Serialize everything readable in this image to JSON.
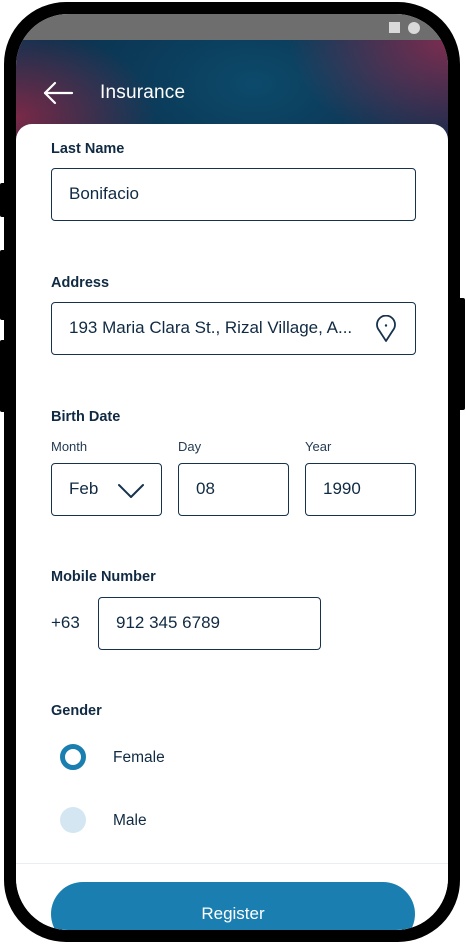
{
  "header": {
    "title": "Insurance",
    "back_icon": "arrow-left-icon"
  },
  "status_bar": {
    "icons": [
      "square-icon",
      "circle-icon",
      "triangle-icon"
    ]
  },
  "form": {
    "last_name": {
      "label": "Last Name",
      "value": "Bonifacio"
    },
    "address": {
      "label": "Address",
      "value": "193 Maria Clara St., Rizal Village, A...",
      "icon": "location-pin-icon"
    },
    "birth_date": {
      "label": "Birth Date",
      "month_label": "Month",
      "month_value": "Feb",
      "day_label": "Day",
      "day_value": "08",
      "year_label": "Year",
      "year_value": "1990"
    },
    "mobile": {
      "label": "Mobile Number",
      "prefix": "+63",
      "value": "912 345 6789"
    },
    "gender": {
      "label": "Gender",
      "options": [
        {
          "label": "Female",
          "selected": true
        },
        {
          "label": "Male",
          "selected": false
        }
      ]
    }
  },
  "actions": {
    "register_label": "Register"
  },
  "colors": {
    "accent": "#1a7fb0",
    "text": "#102a43",
    "radio_unselected": "#d4e6f1",
    "header_dark": "#0b3350"
  }
}
